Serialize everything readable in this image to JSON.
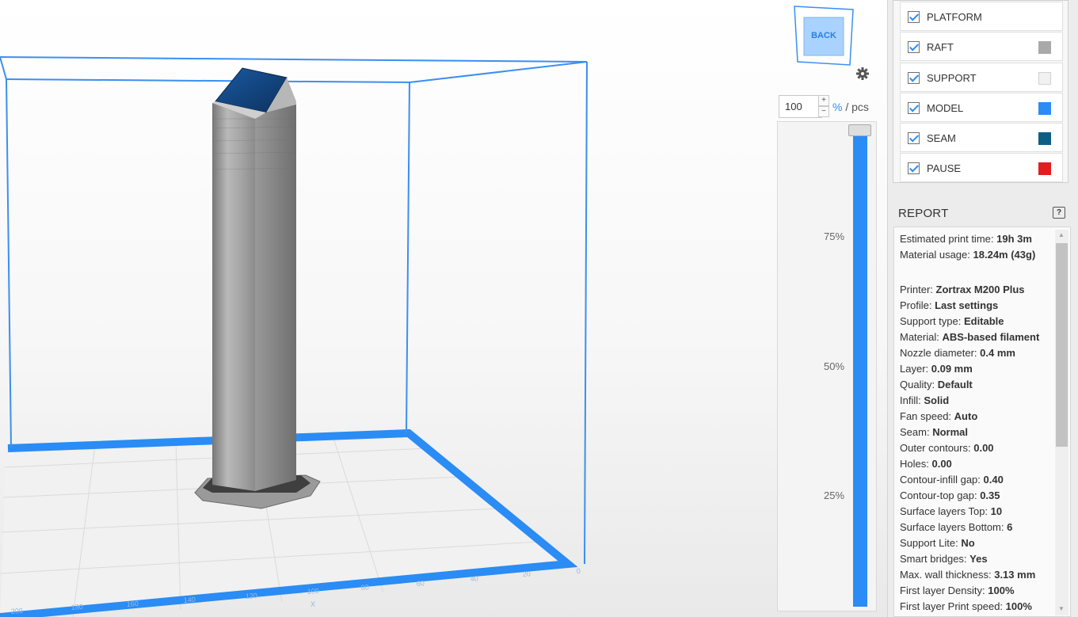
{
  "viewport": {
    "cube_label": "BACK",
    "axis": {
      "x_ticks": [
        "200",
        "180",
        "160",
        "140",
        "120",
        "100",
        "80",
        "60",
        "40",
        "20",
        "0"
      ],
      "x_label": "X"
    },
    "icons": {
      "settings": "gear-icon"
    }
  },
  "quantity": {
    "value": "100",
    "plus": "+",
    "minus": "−",
    "unit_pct": "%",
    "unit_rest": " / pcs"
  },
  "layer_slider": {
    "marks": [
      "75%",
      "50%",
      "25%"
    ],
    "level": 1.0
  },
  "legend": {
    "items": [
      {
        "label": "PLATFORM",
        "checked": true,
        "color": ""
      },
      {
        "label": "RAFT",
        "checked": true,
        "color": "#a9a9a9"
      },
      {
        "label": "SUPPORT",
        "checked": true,
        "color": "#f1f1f1"
      },
      {
        "label": "MODEL",
        "checked": true,
        "color": "#2a8cf4"
      },
      {
        "label": "SEAM",
        "checked": true,
        "color": "#0d5e84"
      },
      {
        "label": "PAUSE",
        "checked": true,
        "color": "#e01f1f"
      }
    ]
  },
  "report": {
    "title": "REPORT",
    "help": "?",
    "rows": [
      {
        "label": "Estimated print time:",
        "value": "19h 3m"
      },
      {
        "label": "Material usage:",
        "value": "18.24m (43g)"
      },
      {
        "label": "Printer:",
        "value": "Zortrax M200 Plus"
      },
      {
        "label": "Profile:",
        "value": "Last settings"
      },
      {
        "label": "Support type:",
        "value": "Editable"
      },
      {
        "label": "Material:",
        "value": "ABS-based filament"
      },
      {
        "label": "Nozzle diameter:",
        "value": "0.4 mm"
      },
      {
        "label": "Layer:",
        "value": "0.09 mm"
      },
      {
        "label": "Quality:",
        "value": "Default"
      },
      {
        "label": "Infill:",
        "value": "Solid"
      },
      {
        "label": "Fan speed:",
        "value": "Auto"
      },
      {
        "label": "Seam:",
        "value": "Normal"
      },
      {
        "label": "Outer contours:",
        "value": "0.00"
      },
      {
        "label": "Holes:",
        "value": "0.00"
      },
      {
        "label": "Contour-infill gap:",
        "value": "0.40"
      },
      {
        "label": "Contour-top gap:",
        "value": "0.35"
      },
      {
        "label": "Surface layers Top:",
        "value": "10"
      },
      {
        "label": "Surface layers Bottom:",
        "value": "6"
      },
      {
        "label": "Support Lite:",
        "value": "No"
      },
      {
        "label": "Smart bridges:",
        "value": "Yes"
      },
      {
        "label": "Max. wall thickness:",
        "value": "3.13 mm"
      },
      {
        "label": "First layer Density:",
        "value": "100%"
      },
      {
        "label": "First layer Print speed:",
        "value": "100%"
      }
    ]
  },
  "colors": {
    "accent": "#2a8cf4",
    "build_volume": "#3b8ff0",
    "model_gray": "#8a8a8a",
    "model_top": "#14457d"
  }
}
